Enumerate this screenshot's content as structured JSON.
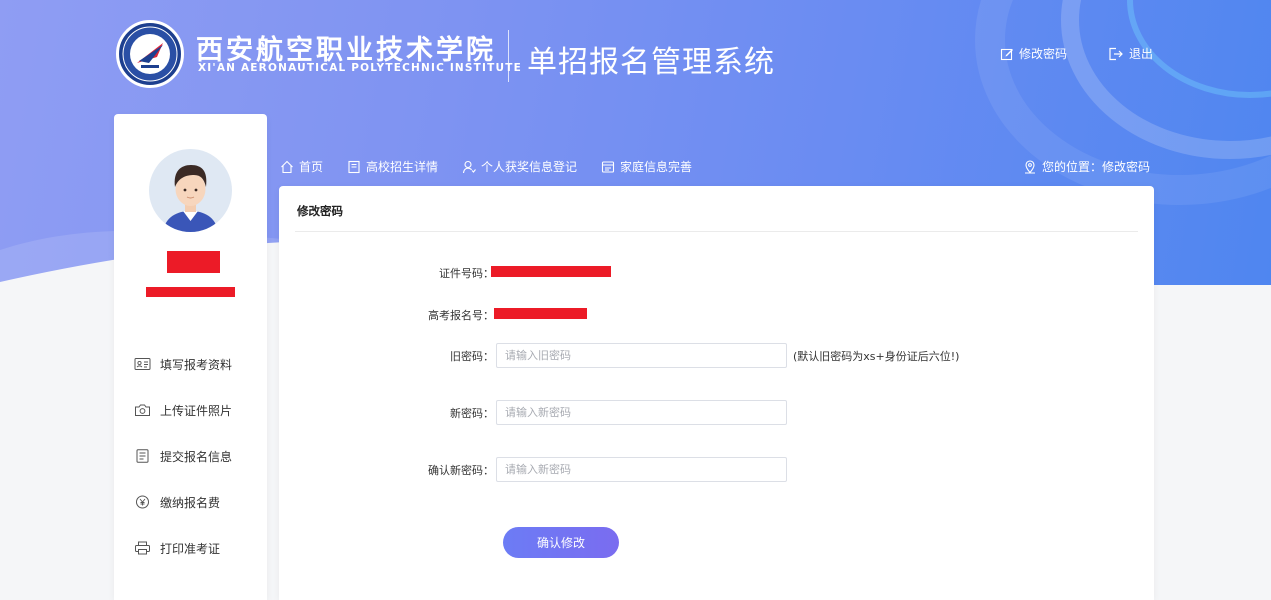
{
  "header": {
    "school_name_cn": "西安航空职业技术学院",
    "school_name_en": "XI'AN AERONAUTICAL POLYTECHNIC INSTITUTE",
    "system_title": "单招报名管理系统",
    "change_password": "修改密码",
    "logout": "退出"
  },
  "sidebar": {
    "items": [
      {
        "label": "填写报考资料",
        "icon": "id-card-icon"
      },
      {
        "label": "上传证件照片",
        "icon": "camera-icon"
      },
      {
        "label": "提交报名信息",
        "icon": "document-icon"
      },
      {
        "label": "缴纳报名费",
        "icon": "yuan-icon"
      },
      {
        "label": "打印准考证",
        "icon": "printer-icon"
      }
    ]
  },
  "nav": {
    "items": [
      {
        "label": "首页",
        "icon": "home-icon"
      },
      {
        "label": "高校招生详情",
        "icon": "book-icon"
      },
      {
        "label": "个人获奖信息登记",
        "icon": "user-icon"
      },
      {
        "label": "家庭信息完善",
        "icon": "family-doc-icon"
      }
    ],
    "location": "您的位置：修改密码"
  },
  "panel": {
    "title": "修改密码",
    "id_label": "证件号码：",
    "exam_label": "高考报名号：",
    "old_pwd_label": "旧密码：",
    "old_pwd_placeholder": "请输入旧密码",
    "old_pwd_hint": "(默认旧密码为xs+身份证后六位!)",
    "new_pwd_label": "新密码：",
    "new_pwd_placeholder": "请输入新密码",
    "confirm_pwd_label": "确认新密码：",
    "confirm_pwd_placeholder": "请输入新密码",
    "submit": "确认修改"
  },
  "colors": {
    "banner_start": "#8f9df3",
    "banner_end": "#4f86f0",
    "button": "#6c7cf5",
    "redaction": "#ec1b27"
  }
}
